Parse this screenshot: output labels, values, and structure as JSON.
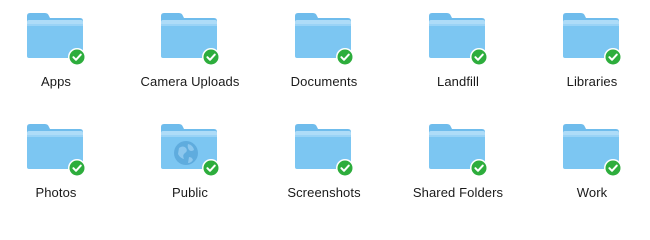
{
  "folders": [
    {
      "label": "Apps",
      "icon": "folder-icon",
      "badge": "sync-complete-icon"
    },
    {
      "label": "Camera Uploads",
      "icon": "folder-icon",
      "badge": "sync-complete-icon"
    },
    {
      "label": "Documents",
      "icon": "folder-icon",
      "badge": "sync-complete-icon"
    },
    {
      "label": "Landfill",
      "icon": "folder-icon",
      "badge": "sync-complete-icon"
    },
    {
      "label": "Libraries",
      "icon": "folder-icon",
      "badge": "sync-complete-icon"
    },
    {
      "label": "Photos",
      "icon": "folder-icon",
      "badge": "sync-complete-icon"
    },
    {
      "label": "Public",
      "icon": "public-folder-icon",
      "badge": "sync-complete-icon"
    },
    {
      "label": "Screenshots",
      "icon": "folder-icon",
      "badge": "sync-complete-icon"
    },
    {
      "label": "Shared Folders",
      "icon": "folder-icon",
      "badge": "sync-complete-icon"
    },
    {
      "label": "Work",
      "icon": "folder-icon",
      "badge": "sync-complete-icon"
    }
  ],
  "colors": {
    "folder_body": "#7cc6f2",
    "folder_tab": "#6fbcec",
    "badge_green": "#2dad3c",
    "label_text": "#1a1a1a"
  }
}
